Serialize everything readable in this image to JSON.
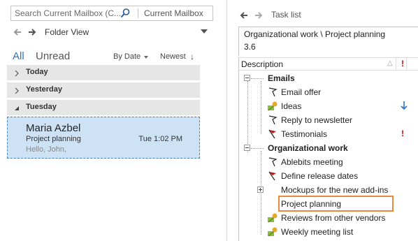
{
  "search": {
    "placeholder": "Search Current Mailbox (C...",
    "scope": "Current Mailbox"
  },
  "navigation": {
    "folder_view_label": "Folder View"
  },
  "filters": {
    "all": "All",
    "unread": "Unread",
    "sort_by": "By Date",
    "sort_order": "Newest",
    "sort_arrow": "↓"
  },
  "groups": {
    "today": "Today",
    "yesterday": "Yesterday",
    "tuesday": "Tuesday"
  },
  "selected_mail": {
    "sender": "Maria Azbel",
    "subject": "Project planning",
    "time": "Tue 1:02 PM",
    "preview": "Hello, John,"
  },
  "task_list": {
    "title": "Task list",
    "path": "Organizational work \\ Project planning",
    "path_value": "3.6",
    "columns": {
      "description": "Description",
      "flag": "△",
      "importance": "!"
    },
    "sections": {
      "emails": "Emails",
      "organizational": "Organizational work"
    },
    "items": {
      "email_offer": "Email offer",
      "ideas": "Ideas",
      "reply_newsletter": "Reply to newsletter",
      "testimonials": "Testimonials",
      "ablebits_meeting": "Ablebits meeting",
      "release_dates": "Define release dates",
      "mockups": "Mockups for the new add-ins",
      "project_planning": "Project planning",
      "reviews": "Reviews from other vendors",
      "weekly_meeting": "Weekly meeting list"
    },
    "importance_mark": "!"
  },
  "colors": {
    "accent_blue": "#2a72c8",
    "selection": "#cde2f5",
    "highlight_orange": "#ec8a3a",
    "flag_red": "#cc1111",
    "importance_red": "#dd0000"
  }
}
